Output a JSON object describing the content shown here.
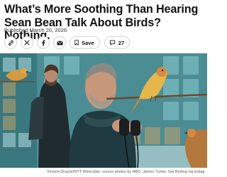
{
  "article": {
    "headline": "What’s More Soothing Than Hearing Sean Bean Talk About Birds? Nothing.",
    "published": "Published March 20, 2026"
  },
  "toolbar": {
    "buttons": [
      {
        "icon": "link-icon"
      },
      {
        "icon": "x-logo-icon"
      },
      {
        "icon": "facebook-icon"
      },
      {
        "icon": "email-icon"
      }
    ],
    "save_label": "Save",
    "comment_count": "27"
  },
  "hero": {
    "caption": "Vincent Drayne/NYT Wirecutter; source photos by HBO, James Turner, Get Birding via Instag"
  },
  "colors": {
    "text": "#121212",
    "border": "#d6d6d6",
    "teal_bg": "#3f7f86",
    "tile_blue": "#8fd0d6",
    "canary_yellow": "#e7b64a",
    "finch_orange": "#d8893e"
  }
}
